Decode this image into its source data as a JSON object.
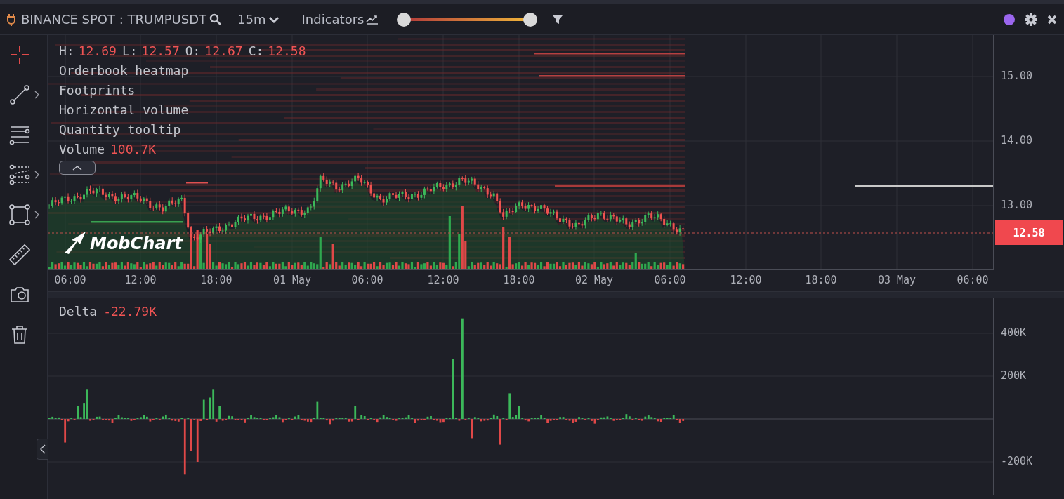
{
  "top_bar": {
    "symbol": "BINANCE SPOT : TRUMPUSDT",
    "interval": "15m",
    "indicators": "Indicators",
    "range_slider": {
      "level": 1
    }
  },
  "toolbar": {
    "tools": [
      {
        "kind": "crosshair",
        "selected": true,
        "submenu": false
      },
      {
        "kind": "line",
        "selected": false,
        "submenu": true
      },
      {
        "kind": "levels",
        "selected": false,
        "submenu": false
      },
      {
        "kind": "channels",
        "selected": false,
        "submenu": true
      },
      {
        "kind": "rectangle",
        "selected": false,
        "submenu": true
      },
      {
        "kind": "ruler",
        "selected": false,
        "submenu": false
      },
      {
        "kind": "camera",
        "selected": false,
        "submenu": false
      },
      {
        "kind": "trash",
        "selected": false,
        "submenu": false
      }
    ]
  },
  "price_pane": {
    "ohlc": [
      {
        "label": "H:",
        "value": "12.69"
      },
      {
        "label": "L:",
        "value": "12.57"
      },
      {
        "label": "O:",
        "value": "12.67"
      },
      {
        "label": "C:",
        "value": "12.58"
      }
    ],
    "layers": [
      "Orderbook heatmap",
      "Footprints",
      "Horizontal volume",
      "Quantity tooltip"
    ],
    "volume": {
      "label": "Volume",
      "value": "100.7K"
    },
    "logo": "MobChart",
    "price_axis": [
      "15.00",
      "14.00",
      "13.00"
    ],
    "last_price": "12.58"
  },
  "time_axis": [
    "06:00",
    "12:00",
    "18:00",
    "01 May",
    "06:00",
    "12:00",
    "18:00",
    "02 May",
    "06:00",
    "12:00",
    "18:00",
    "03 May",
    "06:00"
  ],
  "delta_pane": {
    "label": "Delta",
    "value": "-22.79K",
    "axis": [
      "400K",
      "200K",
      "-200K"
    ]
  }
}
